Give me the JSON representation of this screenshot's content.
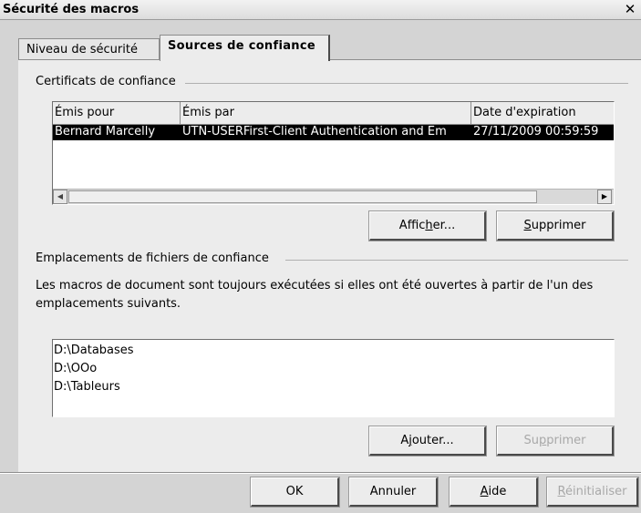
{
  "window": {
    "title": "Sécurité des macros",
    "close_glyph": "✕"
  },
  "tabs": [
    {
      "label": "Niveau de sécurité",
      "active": false
    },
    {
      "label": "Sources de confiance",
      "active": true
    }
  ],
  "certificates": {
    "group_label": "Certificats de confiance",
    "columns": [
      "Émis pour",
      "Émis par",
      "Date d'expiration"
    ],
    "rows": [
      {
        "issued_to": "Bernard Marcelly",
        "issued_by": "UTN-USERFirst-Client Authentication and Em",
        "expiration": "27/11/2009 00:59:59",
        "selected": true
      }
    ],
    "view_button": {
      "pre": "Affic",
      "accel": "h",
      "post": "er..."
    },
    "remove_button": {
      "pre": "",
      "accel": "S",
      "post": "upprimer"
    }
  },
  "locations": {
    "group_label": "Emplacements de fichiers de confiance",
    "description": "Les macros de document sont toujours exécutées si elles ont été ouvertes à partir de l'un des emplacements suivants.",
    "items": [
      "D:\\Databases",
      "D:\\OOo",
      "D:\\Tableurs"
    ],
    "add_button": {
      "pre": "A",
      "accel": "j",
      "post": "outer..."
    },
    "remove_button": {
      "pre": "Su",
      "accel": "p",
      "post": "primer",
      "disabled": true
    }
  },
  "footer": {
    "ok": "OK",
    "cancel": "Annuler",
    "help": {
      "pre": "",
      "accel": "A",
      "post": "ide"
    },
    "reset": {
      "pre": "",
      "accel": "R",
      "post": "éinitialiser",
      "disabled": true
    }
  },
  "icons": {
    "scroll_left": "◀",
    "scroll_right": "▶"
  },
  "colors": {
    "window_bg": "#ececec",
    "selection_bg": "#000000",
    "selection_fg": "#ffffff",
    "disabled_text": "#a8a8a8"
  }
}
